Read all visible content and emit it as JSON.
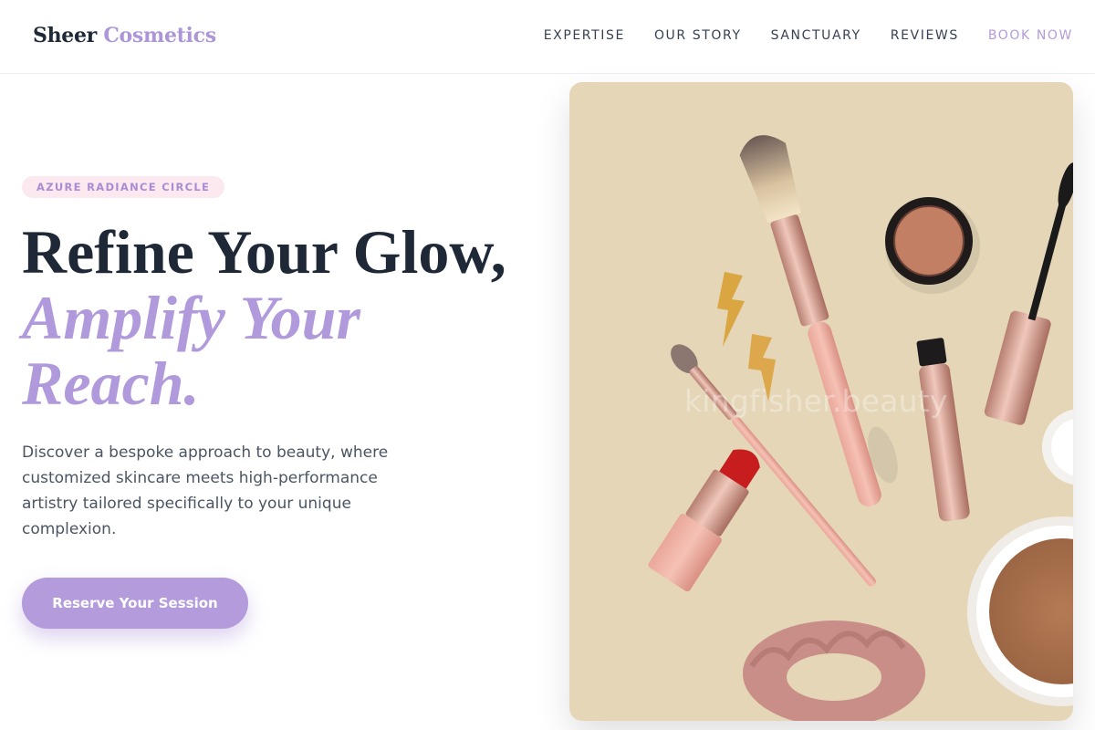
{
  "brand": {
    "name_part1": "Sheer",
    "name_part2": "Cosmetics"
  },
  "nav": {
    "items": [
      "EXPERTISE",
      "OUR STORY",
      "SANCTUARY",
      "REVIEWS"
    ],
    "book_label": "BOOK NOW"
  },
  "hero": {
    "badge": "AZURE RADIANCE CIRCLE",
    "headline_line1": "Refine Your Glow,",
    "headline_line2": "Amplify Your",
    "headline_line3": "Reach.",
    "description": "Discover a bespoke approach to beauty, where customized skincare meets high-performance artistry tailored specifically to your unique complexion.",
    "cta_label": "Reserve Your Session",
    "image_watermark": "kingfisher.beauty"
  },
  "colors": {
    "accent": "#b39bdc",
    "heading": "#1e2836",
    "badge_bg": "#fbe9ef",
    "image_bg": "#e4d6b7"
  }
}
